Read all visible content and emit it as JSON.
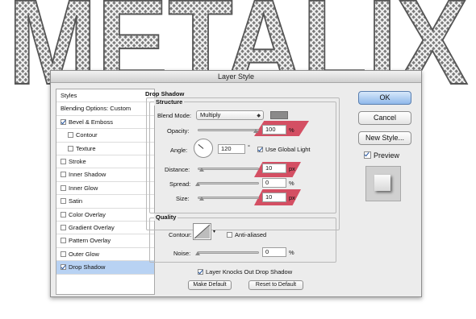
{
  "background_text": "METALIX",
  "dialog": {
    "title": "Layer Style",
    "styles_header": "Styles",
    "blending_options": "Blending Options: Custom",
    "style_items": [
      {
        "label": "Bevel & Emboss",
        "checked": true,
        "indent": false,
        "selected": false
      },
      {
        "label": "Contour",
        "checked": false,
        "indent": true,
        "selected": false
      },
      {
        "label": "Texture",
        "checked": false,
        "indent": true,
        "selected": false
      },
      {
        "label": "Stroke",
        "checked": false,
        "indent": false,
        "selected": false
      },
      {
        "label": "Inner Shadow",
        "checked": false,
        "indent": false,
        "selected": false
      },
      {
        "label": "Inner Glow",
        "checked": false,
        "indent": false,
        "selected": false
      },
      {
        "label": "Satin",
        "checked": false,
        "indent": false,
        "selected": false
      },
      {
        "label": "Color Overlay",
        "checked": false,
        "indent": false,
        "selected": false
      },
      {
        "label": "Gradient Overlay",
        "checked": false,
        "indent": false,
        "selected": false
      },
      {
        "label": "Pattern Overlay",
        "checked": false,
        "indent": false,
        "selected": false
      },
      {
        "label": "Outer Glow",
        "checked": false,
        "indent": false,
        "selected": false
      },
      {
        "label": "Drop Shadow",
        "checked": true,
        "indent": false,
        "selected": true
      }
    ],
    "drop_shadow": {
      "header": "Drop Shadow",
      "structure_header": "Structure",
      "blend_mode_label": "Blend Mode:",
      "blend_mode_value": "Multiply",
      "shadow_color": "#8a8a8a",
      "opacity_label": "Opacity:",
      "opacity_value": "100",
      "opacity_unit": "%",
      "angle_label": "Angle:",
      "angle_value": "120",
      "angle_unit": "°",
      "use_global_light_label": "Use Global Light",
      "use_global_light_checked": true,
      "distance_label": "Distance:",
      "distance_value": "10",
      "distance_unit": "px",
      "spread_label": "Spread:",
      "spread_value": "0",
      "spread_unit": "%",
      "size_label": "Size:",
      "size_value": "10",
      "size_unit": "px",
      "quality_header": "Quality",
      "contour_label": "Contour:",
      "anti_aliased_label": "Anti-aliased",
      "anti_aliased_checked": false,
      "noise_label": "Noise:",
      "noise_value": "0",
      "noise_unit": "%",
      "knocks_out_label": "Layer Knocks Out Drop Shadow",
      "knocks_out_checked": true,
      "make_default_label": "Make Default",
      "reset_default_label": "Reset to Default"
    },
    "buttons": {
      "ok": "OK",
      "cancel": "Cancel",
      "new_style": "New Style...",
      "preview_label": "Preview",
      "preview_checked": true
    }
  },
  "highlight_color": "#cd233c"
}
